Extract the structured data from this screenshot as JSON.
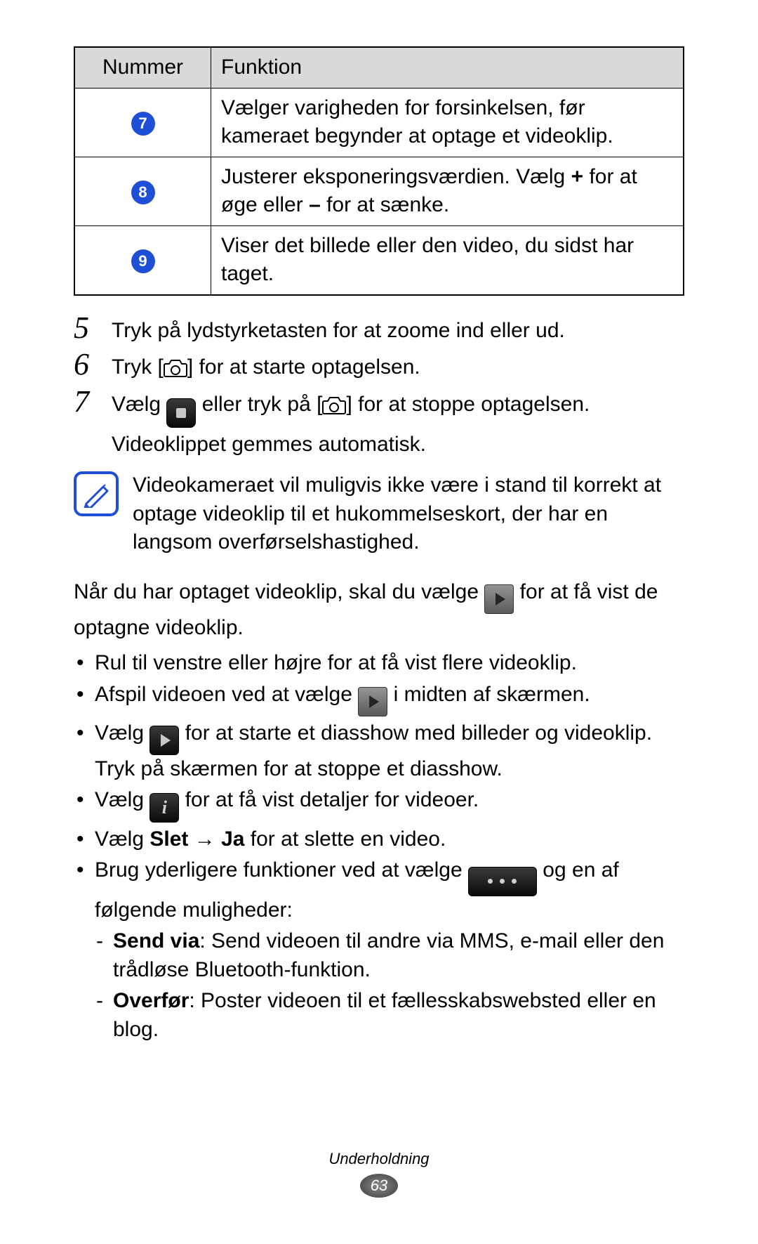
{
  "table": {
    "headers": {
      "number": "Nummer",
      "function": "Funktion"
    },
    "rows": [
      {
        "num": "7",
        "text": "Vælger varigheden for forsinkelsen, før kameraet begynder at optage et videoklip."
      },
      {
        "num": "8",
        "prefix": "Justerer eksponeringsværdien. Vælg ",
        "plus": "+",
        "mid1": " for at øge eller ",
        "minus": "–",
        "suffix": " for at sænke."
      },
      {
        "num": "9",
        "text": "Viser det billede eller den video, du sidst har taget."
      }
    ]
  },
  "steps": [
    {
      "num": "5",
      "text": "Tryk på lydstyrketasten for at zoome ind eller ud."
    },
    {
      "num": "6",
      "pre": "Tryk [",
      "post": "] for at starte optagelsen."
    },
    {
      "num": "7",
      "pre": "Vælg ",
      "mid": " eller tryk på [",
      "post": "] for at stoppe optagelsen.",
      "line2": "Videoklippet gemmes automatisk."
    }
  ],
  "note": "Videokameraet vil muligvis ikke være i stand til korrekt at optage videoklip til et hukommelseskort, der har en langsom overførselshastighed.",
  "after_record": {
    "pre": "Når du har optaget videoklip, skal du vælge ",
    "post": " for at få vist de optagne videoklip."
  },
  "bullets": {
    "b1": "Rul til venstre eller højre for at få vist flere videoklip.",
    "b2_pre": "Afspil videoen ved at vælge ",
    "b2_post": " i midten af skærmen.",
    "b3_pre": "Vælg ",
    "b3_post": " for at starte et diasshow med billeder og videoklip. Tryk på skærmen for at stoppe et diasshow.",
    "b4_pre": "Vælg ",
    "b4_post": " for at få vist detaljer for videoer.",
    "b5_pre": "Vælg ",
    "b5_slet": "Slet",
    "b5_arrow": " → ",
    "b5_ja": "Ja",
    "b5_post": " for at slette en video.",
    "b6_pre": "Brug yderligere funktioner ved at vælge ",
    "b6_post": " og en af følgende muligheder:",
    "sub1_label": "Send via",
    "sub1_text": ": Send videoen til andre via MMS, e-mail eller den trådløse Bluetooth-funktion.",
    "sub2_label": "Overfør",
    "sub2_text": ": Poster videoen til et fællesskabswebsted eller en blog."
  },
  "footer": {
    "section": "Underholdning",
    "page": "63"
  }
}
